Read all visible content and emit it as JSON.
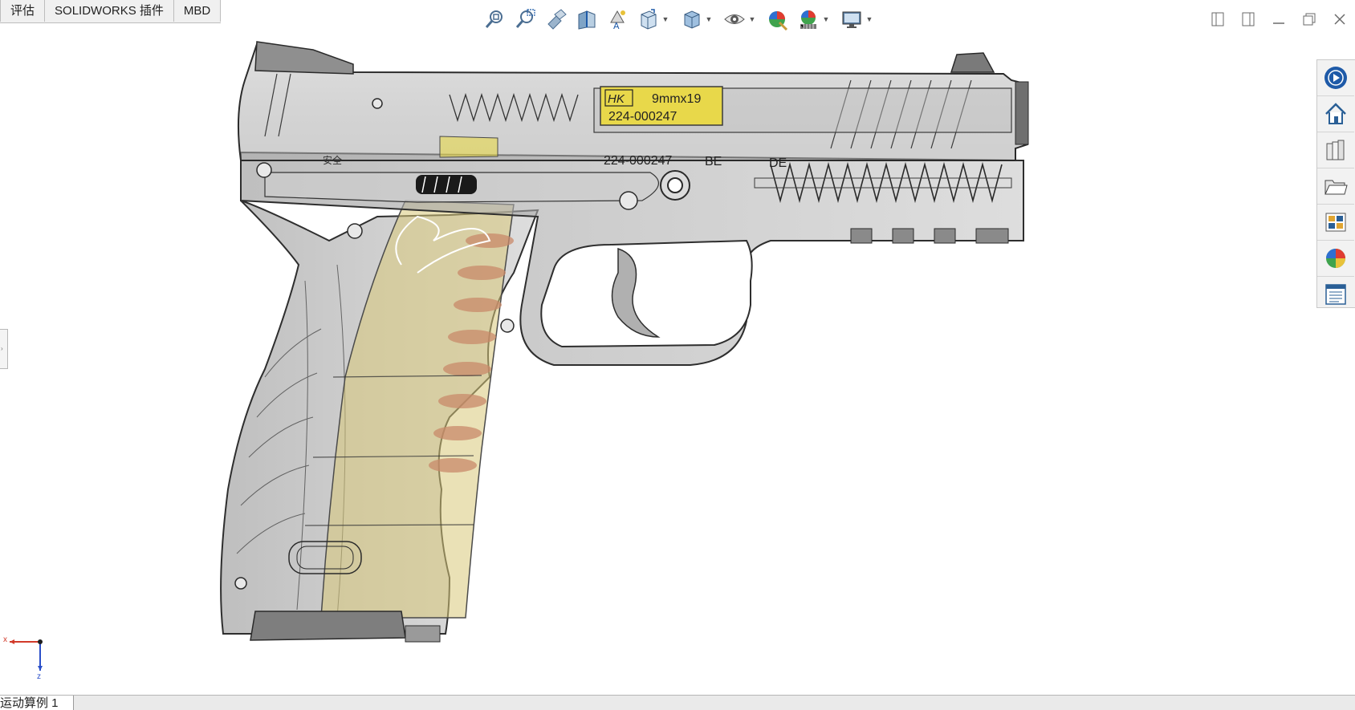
{
  "command_tabs": [
    {
      "label": "评估"
    },
    {
      "label": "SOLIDWORKS 插件"
    },
    {
      "label": "MBD"
    }
  ],
  "heads_up_toolbar": [
    {
      "icon": "zoom-to-fit-icon",
      "has_dropdown": false
    },
    {
      "icon": "zoom-to-area-icon",
      "has_dropdown": false
    },
    {
      "icon": "previous-view-icon",
      "has_dropdown": false
    },
    {
      "icon": "section-view-icon",
      "has_dropdown": false
    },
    {
      "icon": "dynamic-annotation-views-icon",
      "has_dropdown": false
    },
    {
      "icon": "view-orientation-icon",
      "has_dropdown": true
    },
    {
      "icon": "display-style-icon",
      "has_dropdown": true
    },
    {
      "icon": "hide-show-items-icon",
      "has_dropdown": true
    },
    {
      "icon": "edit-appearance-icon",
      "has_dropdown": false
    },
    {
      "icon": "apply-scene-icon",
      "has_dropdown": true
    },
    {
      "icon": "view-settings-icon",
      "has_dropdown": true
    }
  ],
  "window_controls": [
    "tile-left-icon",
    "tile-right-icon",
    "minimize-icon",
    "restore-icon",
    "close-icon"
  ],
  "task_pane": [
    {
      "icon": "solidworks-resources-icon"
    },
    {
      "icon": "home-icon"
    },
    {
      "icon": "design-library-icon"
    },
    {
      "icon": "file-explorer-icon"
    },
    {
      "icon": "view-palette-icon"
    },
    {
      "icon": "appearances-scenes-icon"
    },
    {
      "icon": "custom-properties-icon"
    }
  ],
  "model": {
    "cartridge_brand": "HK",
    "cartridge_caliber": "9mmx19",
    "cartridge_part_no": "224-000247",
    "frame_marking": "224-000247",
    "frame_suffix": "BE",
    "frame_country": "DE",
    "frame_stamp": "安全"
  },
  "triad": {
    "x_label": "x",
    "z_label": "z"
  },
  "bottom_tabs": [
    {
      "label": "运动算例 1"
    }
  ],
  "colors": {
    "accent_blue": "#1e5aa8",
    "cartridge_yellow": "#e8d84a",
    "round_copper": "#c98a6a",
    "model_grey": "#8a8a8a",
    "triad_red": "#d23a2a",
    "triad_blue": "#2a4fc9"
  }
}
